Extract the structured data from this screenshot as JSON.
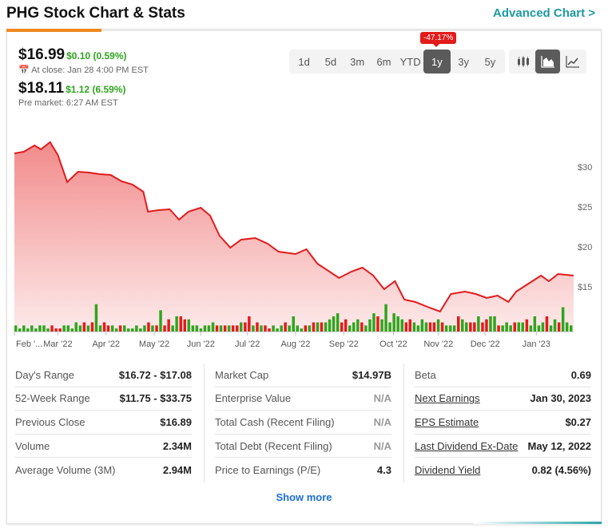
{
  "header": {
    "title": "PHG Stock Chart & Stats",
    "advanced_link": "Advanced Chart >"
  },
  "quote": {
    "close_price": "$16.99",
    "close_change": "$0.10 (0.59%)",
    "close_time": "At close: Jan 28 4:00 PM EST",
    "pre_price": "$18.11",
    "pre_change": "$1.12 (6.59%)",
    "pre_time": "Pre market: 6:27 AM EST"
  },
  "ranges": [
    "1d",
    "5d",
    "3m",
    "6m",
    "YTD",
    "1y",
    "3y",
    "5y"
  ],
  "selected_range": "1y",
  "range_change_badge": "-47.17%",
  "chart_types": [
    {
      "icon": "candlestick-icon"
    },
    {
      "icon": "mountain-chart-icon",
      "active": true
    },
    {
      "icon": "line-chart-icon"
    }
  ],
  "colors": {
    "line": "#e31b1b",
    "area_top": "#f28b8b",
    "up": "#2fa51d",
    "down": "#e31b1b",
    "accent": "#1e9aa0"
  },
  "chart_data": {
    "type": "area",
    "y_ticks": [
      "$15",
      "$20",
      "$25",
      "$30"
    ],
    "y_tick_values": [
      15,
      20,
      25,
      30
    ],
    "ylim": [
      9.5,
      34
    ],
    "x_range": [
      "2022-02-01",
      "2023-01-27"
    ],
    "x_ticks": [
      [
        "2022-02-01",
        "Feb '..."
      ],
      [
        "2022-03-01",
        "Mar '22"
      ],
      [
        "2022-04-01",
        "Apr '22"
      ],
      [
        "2022-05-02",
        "May '22"
      ],
      [
        "2022-06-01",
        "Jun '22"
      ],
      [
        "2022-07-01",
        "Jul '22"
      ],
      [
        "2022-08-01",
        "Aug '22"
      ],
      [
        "2022-09-01",
        "Sep '22"
      ],
      [
        "2022-10-03",
        "Oct '22"
      ],
      [
        "2022-11-01",
        "Nov '22"
      ],
      [
        "2022-12-01",
        "Dec '22"
      ],
      [
        "2023-01-03",
        "Jan '23"
      ]
    ],
    "series": [
      [
        "2022-02-01",
        31.7
      ],
      [
        "2022-02-07",
        31.9
      ],
      [
        "2022-02-14",
        32.7
      ],
      [
        "2022-02-18",
        32.2
      ],
      [
        "2022-02-24",
        33.1
      ],
      [
        "2022-03-01",
        31.5
      ],
      [
        "2022-03-07",
        28.1
      ],
      [
        "2022-03-14",
        29.4
      ],
      [
        "2022-03-21",
        29.3
      ],
      [
        "2022-03-28",
        29.1
      ],
      [
        "2022-04-04",
        29.0
      ],
      [
        "2022-04-11",
        28.2
      ],
      [
        "2022-04-18",
        27.8
      ],
      [
        "2022-04-25",
        26.9
      ],
      [
        "2022-04-28",
        24.4
      ],
      [
        "2022-05-05",
        24.6
      ],
      [
        "2022-05-12",
        24.7
      ],
      [
        "2022-05-18",
        23.4
      ],
      [
        "2022-05-24",
        24.4
      ],
      [
        "2022-06-01",
        24.9
      ],
      [
        "2022-06-07",
        23.9
      ],
      [
        "2022-06-13",
        21.4
      ],
      [
        "2022-06-20",
        19.9
      ],
      [
        "2022-06-27",
        20.9
      ],
      [
        "2022-07-06",
        21.1
      ],
      [
        "2022-07-14",
        20.4
      ],
      [
        "2022-07-21",
        19.4
      ],
      [
        "2022-08-01",
        19.1
      ],
      [
        "2022-08-08",
        19.7
      ],
      [
        "2022-08-15",
        17.9
      ],
      [
        "2022-08-29",
        16.1
      ],
      [
        "2022-09-06",
        16.9
      ],
      [
        "2022-09-13",
        17.4
      ],
      [
        "2022-09-20",
        16.4
      ],
      [
        "2022-09-27",
        14.7
      ],
      [
        "2022-10-04",
        15.7
      ],
      [
        "2022-10-10",
        13.4
      ],
      [
        "2022-10-17",
        13.1
      ],
      [
        "2022-10-26",
        12.4
      ],
      [
        "2022-11-02",
        11.9
      ],
      [
        "2022-11-09",
        14.1
      ],
      [
        "2022-11-18",
        14.4
      ],
      [
        "2022-11-25",
        14.1
      ],
      [
        "2022-12-02",
        13.6
      ],
      [
        "2022-12-09",
        13.9
      ],
      [
        "2022-12-16",
        13.1
      ],
      [
        "2022-12-21",
        14.4
      ],
      [
        "2022-12-29",
        15.4
      ],
      [
        "2023-01-06",
        16.4
      ],
      [
        "2023-01-11",
        15.7
      ],
      [
        "2023-01-17",
        16.6
      ],
      [
        "2023-01-27",
        16.4
      ]
    ],
    "volume": [
      2,
      1,
      2,
      1,
      2,
      1,
      2,
      2,
      1,
      -2,
      -1,
      -1,
      2,
      2,
      1,
      3,
      2,
      -3,
      2,
      -3,
      9,
      2,
      -3,
      -2,
      2,
      1,
      -2,
      2,
      1,
      1,
      2,
      1,
      2,
      -3,
      2,
      -2,
      7,
      -2,
      -4,
      2,
      5,
      -5,
      -4,
      4,
      2,
      2,
      1,
      2,
      2,
      3,
      -2,
      2,
      -2,
      2,
      -2,
      -2,
      3,
      -3,
      -5,
      2,
      -3,
      2,
      -2,
      -1,
      2,
      1,
      2,
      -3,
      2,
      5,
      2,
      1,
      -2,
      2,
      -3,
      3,
      -3,
      3,
      4,
      5,
      6,
      -3,
      -4,
      2,
      3,
      4,
      -3,
      2,
      4,
      6,
      -5,
      4,
      9,
      3,
      6,
      5,
      4,
      -3,
      -4,
      3,
      2,
      4,
      3,
      -3,
      -3,
      4,
      -3,
      2,
      2,
      2,
      -5,
      4,
      3,
      -3,
      -3,
      5,
      -3,
      -4,
      5,
      5,
      -2,
      2,
      3,
      2,
      -3,
      3,
      3,
      -4,
      2,
      5,
      2,
      3,
      -5,
      2,
      4,
      -3,
      8,
      3,
      2
    ]
  },
  "stats": [
    [
      {
        "label": "Day's Range",
        "value": "$16.72 - $17.08"
      },
      {
        "label": "52-Week Range",
        "value": "$11.75 - $33.75"
      },
      {
        "label": "Previous Close",
        "value": "$16.89"
      },
      {
        "label": "Volume",
        "value": "2.34M"
      },
      {
        "label": "Average Volume (3M)",
        "value": "2.94M"
      }
    ],
    [
      {
        "label": "Market Cap",
        "value": "$14.97B"
      },
      {
        "label": "Enterprise Value",
        "value": "N/A"
      },
      {
        "label": "Total Cash (Recent Filing)",
        "value": "N/A"
      },
      {
        "label": "Total Debt (Recent Filing)",
        "value": "N/A"
      },
      {
        "label": "Price to Earnings (P/E)",
        "value": "4.3"
      }
    ],
    [
      {
        "label": "Beta",
        "value": "0.69"
      },
      {
        "label": "Next Earnings",
        "value": "Jan 30, 2023",
        "link": true
      },
      {
        "label": "EPS Estimate",
        "value": "$0.27",
        "link": true
      },
      {
        "label": "Last Dividend Ex-Date",
        "value": "May 12, 2022",
        "link": true
      },
      {
        "label": "Dividend Yield",
        "value": "0.82 (4.56%)",
        "link": true
      }
    ]
  ],
  "show_more": "Show more"
}
